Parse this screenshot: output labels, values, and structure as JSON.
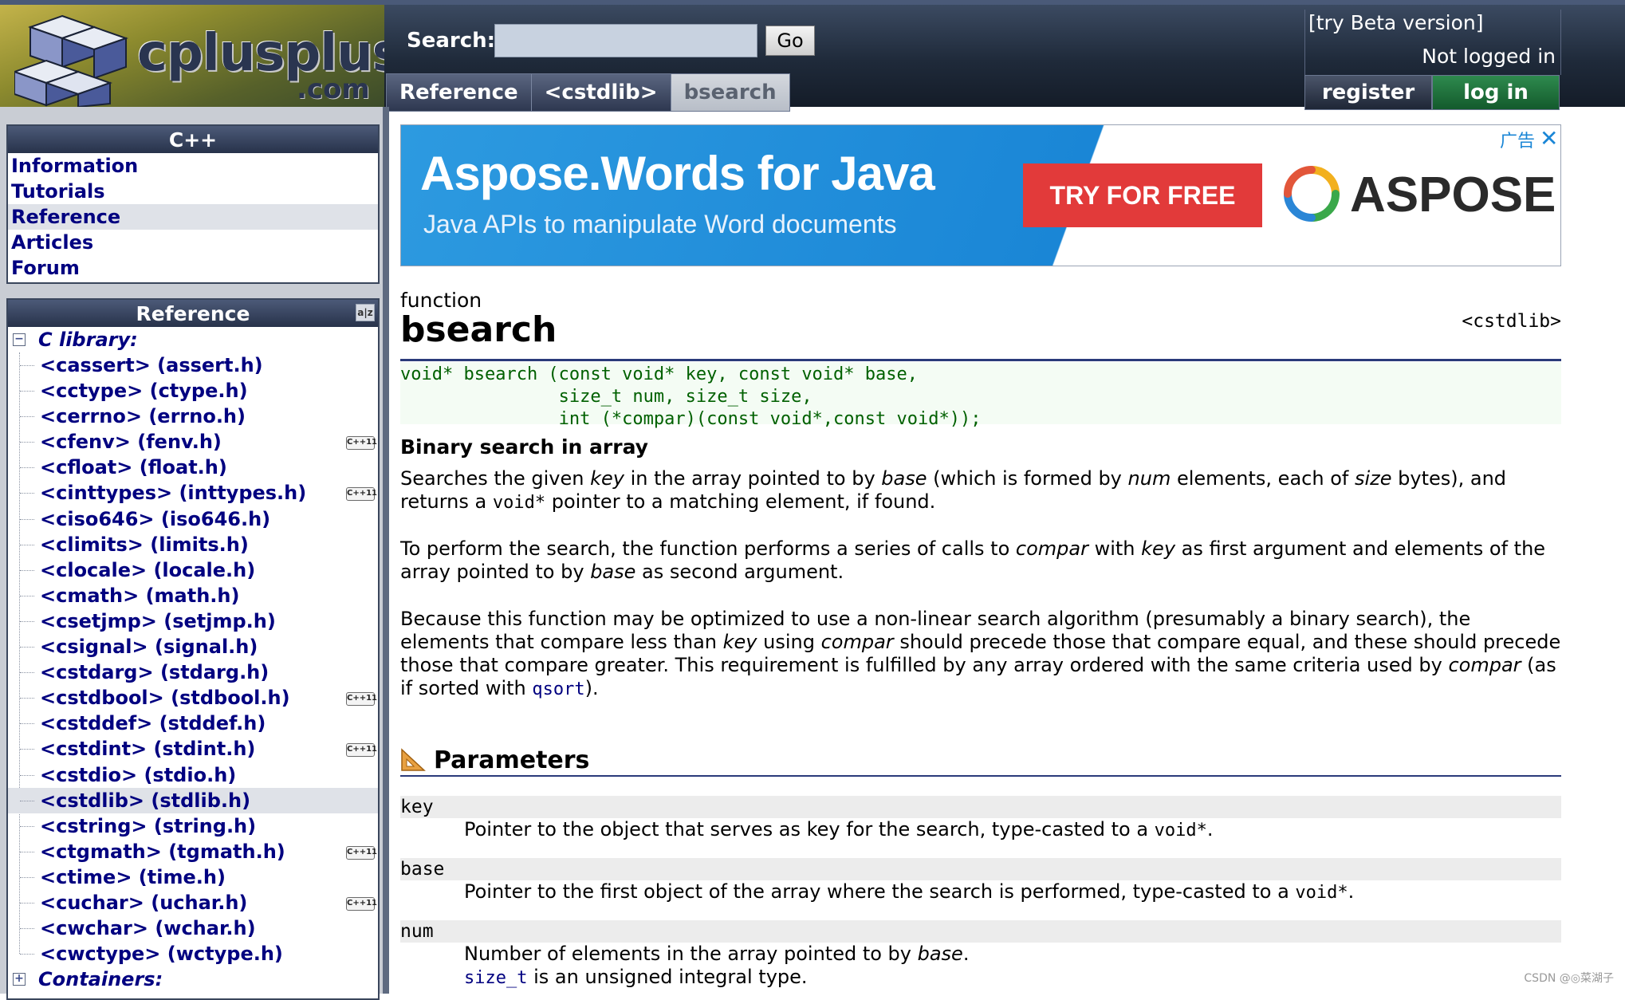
{
  "header": {
    "logo_text": "cplusplus",
    "logo_sub": ".com",
    "search_label": "Search:",
    "search_value": "",
    "go_label": "Go",
    "breadcrumb": [
      "Reference",
      "<cstdlib>",
      "bsearch"
    ],
    "beta_link": "[try Beta version]",
    "login_status": "Not logged in",
    "register_label": "register",
    "login_label": "log in"
  },
  "sidebar": {
    "cpp_title": "C++",
    "cpp_items": [
      "Information",
      "Tutorials",
      "Reference",
      "Articles",
      "Forum"
    ],
    "cpp_selected_index": 2,
    "ref_title": "Reference",
    "c_library_label": "C library:",
    "library_items": [
      {
        "label": "<cassert> (assert.h)",
        "cpp11": false
      },
      {
        "label": "<cctype> (ctype.h)",
        "cpp11": false
      },
      {
        "label": "<cerrno> (errno.h)",
        "cpp11": false
      },
      {
        "label": "<cfenv> (fenv.h)",
        "cpp11": true
      },
      {
        "label": "<cfloat> (float.h)",
        "cpp11": false
      },
      {
        "label": "<cinttypes> (inttypes.h)",
        "cpp11": true
      },
      {
        "label": "<ciso646> (iso646.h)",
        "cpp11": false
      },
      {
        "label": "<climits> (limits.h)",
        "cpp11": false
      },
      {
        "label": "<clocale> (locale.h)",
        "cpp11": false
      },
      {
        "label": "<cmath> (math.h)",
        "cpp11": false
      },
      {
        "label": "<csetjmp> (setjmp.h)",
        "cpp11": false
      },
      {
        "label": "<csignal> (signal.h)",
        "cpp11": false
      },
      {
        "label": "<cstdarg> (stdarg.h)",
        "cpp11": false
      },
      {
        "label": "<cstdbool> (stdbool.h)",
        "cpp11": true
      },
      {
        "label": "<cstddef> (stddef.h)",
        "cpp11": false
      },
      {
        "label": "<cstdint> (stdint.h)",
        "cpp11": true
      },
      {
        "label": "<cstdio> (stdio.h)",
        "cpp11": false
      },
      {
        "label": "<cstdlib> (stdlib.h)",
        "cpp11": false,
        "selected": true
      },
      {
        "label": "<cstring> (string.h)",
        "cpp11": false
      },
      {
        "label": "<ctgmath> (tgmath.h)",
        "cpp11": true
      },
      {
        "label": "<ctime> (time.h)",
        "cpp11": false
      },
      {
        "label": "<cuchar> (uchar.h)",
        "cpp11": true
      },
      {
        "label": "<cwchar> (wchar.h)",
        "cpp11": false
      },
      {
        "label": "<cwctype> (wctype.h)",
        "cpp11": false
      }
    ],
    "cpp11_badge": "C++11",
    "containers_label": "Containers:"
  },
  "ad": {
    "title": "Aspose.Words for Java",
    "subtitle": "Java APIs to manipulate Word documents",
    "cta": "TRY FOR FREE",
    "brand": "ASPOSE",
    "label": "广告",
    "close": "✕"
  },
  "article": {
    "kind": "function",
    "title": "bsearch",
    "header_ref": "<cstdlib>",
    "prototype": "void* bsearch (const void* key, const void* base,\n               size_t num, size_t size,\n               int (*compar)(const void*,const void*));",
    "brief": "Binary search in array",
    "para1": {
      "t1": "Searches the given ",
      "v1": "key",
      "t2": " in the array pointed to by ",
      "v2": "base",
      "t3": " (which is formed by ",
      "v3": "num",
      "t4": " elements, each of ",
      "v4": "size",
      "t5": " bytes), and returns a ",
      "c1": "void*",
      "t6": " pointer to a matching element, if found."
    },
    "para2": {
      "t1": "To perform the search, the function performs a series of calls to ",
      "v1": "compar",
      "t2": " with ",
      "v2": "key",
      "t3": " as first argument and elements of the array pointed to by ",
      "v3": "base",
      "t4": " as second argument."
    },
    "para3": {
      "t1": "Because this function may be optimized to use a non-linear search algorithm (presumably a binary search), the elements that compare less than ",
      "v1": "key",
      "t2": " using ",
      "v2": "compar",
      "t3": " should precede those that compare equal, and these should precede those that compare greater. This requirement is fulfilled by any array ordered with the same criteria used by ",
      "v3": "compar",
      "t4": " (as if sorted with ",
      "l1": "qsort",
      "t5": ")."
    },
    "params_title": "Parameters",
    "params": [
      {
        "name": "key",
        "d1": "Pointer to the object that serves as key for the search, type-casted to a ",
        "c1": "void*",
        "d2": "."
      },
      {
        "name": "base",
        "d1": "Pointer to the first object of the array where the search is performed, type-casted to a ",
        "c1": "void*",
        "d2": "."
      },
      {
        "name": "num",
        "d1": "Number of elements in the array pointed to by ",
        "v1": "base",
        "d2": ".",
        "l1": "size_t",
        "d3": " is an unsigned integral type."
      }
    ]
  },
  "watermark": "CSDN @◎菜湖子",
  "colors": {
    "link": "#000080",
    "prototype_text": "#006000",
    "ad_blue": "#1a86d6",
    "ad_cta": "#e23a3a",
    "login_green": "#1f7a40"
  }
}
